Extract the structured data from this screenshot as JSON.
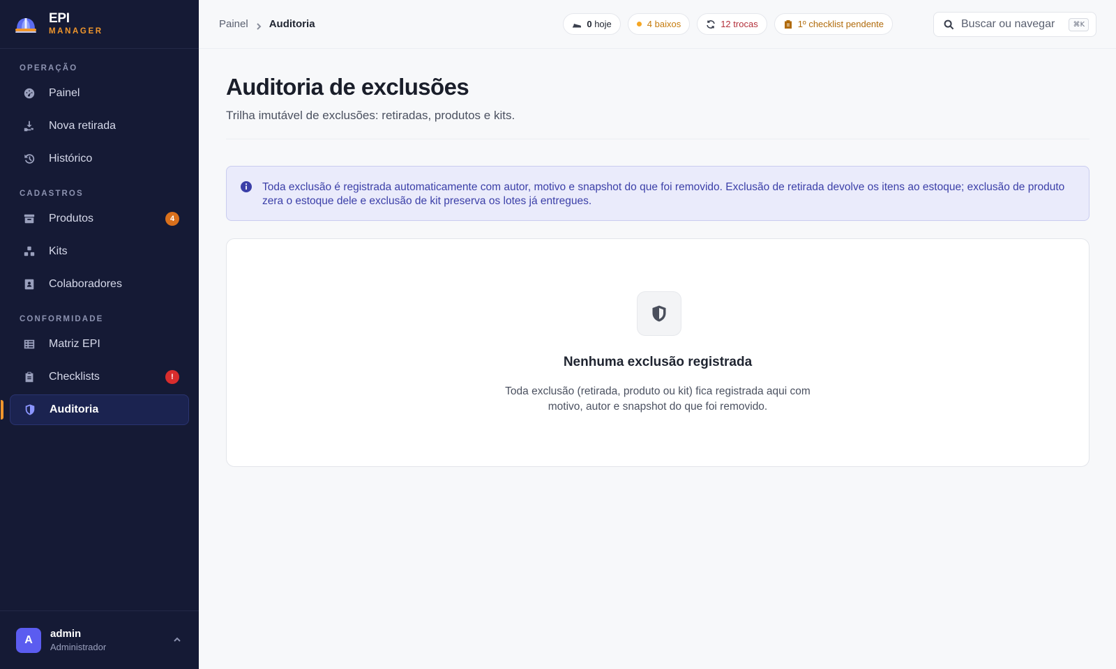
{
  "brand": {
    "name": "EPI",
    "sub": "MANAGER"
  },
  "sidebar": {
    "sections": [
      {
        "heading": "OPERAÇÃO",
        "items": [
          {
            "label": "Painel",
            "icon": "dashboard-icon"
          },
          {
            "label": "Nova retirada",
            "icon": "hand-give-icon"
          },
          {
            "label": "Histórico",
            "icon": "history-icon"
          }
        ]
      },
      {
        "heading": "CADASTROS",
        "items": [
          {
            "label": "Produtos",
            "icon": "box-icon",
            "badge": "4"
          },
          {
            "label": "Kits",
            "icon": "kit-icon"
          },
          {
            "label": "Colaboradores",
            "icon": "badge-id-icon"
          }
        ]
      },
      {
        "heading": "CONFORMIDADE",
        "items": [
          {
            "label": "Matriz EPI",
            "icon": "table-icon"
          },
          {
            "label": "Checklists",
            "icon": "clipboard-icon",
            "badge": "!"
          },
          {
            "label": "Auditoria",
            "icon": "shield-icon",
            "active": true
          }
        ]
      }
    ]
  },
  "user": {
    "initial": "A",
    "name": "admin",
    "role": "Administrador"
  },
  "breadcrumb": {
    "root": "Painel",
    "current": "Auditoria"
  },
  "chips": {
    "today": {
      "value": "0",
      "label": "hoje"
    },
    "low": {
      "value": "4",
      "label": "baixos"
    },
    "swaps": {
      "value": "12",
      "label": "trocas"
    },
    "checklist": {
      "value": "1º",
      "label": "checklist pendente"
    }
  },
  "search": {
    "placeholder": "Buscar ou navegar",
    "shortcut": "⌘K"
  },
  "page": {
    "title": "Auditoria de exclusões",
    "subtitle": "Trilha imutável de exclusões: retiradas, produtos e kits."
  },
  "info": {
    "text": "Toda exclusão é registrada automaticamente com autor, motivo e snapshot do que foi removido. Exclusão de retirada devolve os itens ao estoque; exclusão de produto zera o estoque dele e exclusão de kit preserva os lotes já entregues."
  },
  "empty": {
    "title": "Nenhuma exclusão registrada",
    "description": "Toda exclusão (retirada, produto ou kit) fica registrada aqui com motivo, autor e snapshot do que foi removido."
  },
  "colors": {
    "accent": "#5b5cf0",
    "brandOrange": "#f0962c",
    "sidebarBg": "#151a35"
  }
}
